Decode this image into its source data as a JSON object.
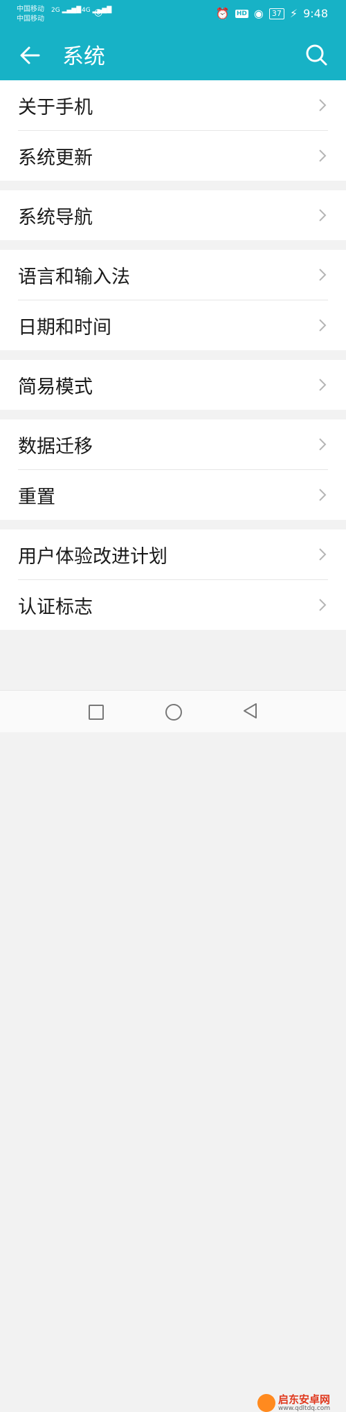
{
  "status_bar": {
    "carrier1": "中国移动",
    "carrier2": "中国移动",
    "sig1": "2G",
    "sig2": "4G",
    "battery": "37",
    "hd": "HD",
    "time": "9:48"
  },
  "header": {
    "title": "系统"
  },
  "groups": [
    [
      "关于手机",
      "系统更新"
    ],
    [
      "系统导航"
    ],
    [
      "语言和输入法",
      "日期和时间"
    ],
    [
      "简易模式"
    ],
    [
      "数据迁移",
      "重置"
    ],
    [
      "用户体验改进计划",
      "认证标志"
    ]
  ],
  "watermark": {
    "name": "启东安卓网",
    "url": "www.qdltdq.com"
  },
  "colors": {
    "accent": "#17b2c6",
    "background": "#f2f2f2"
  }
}
